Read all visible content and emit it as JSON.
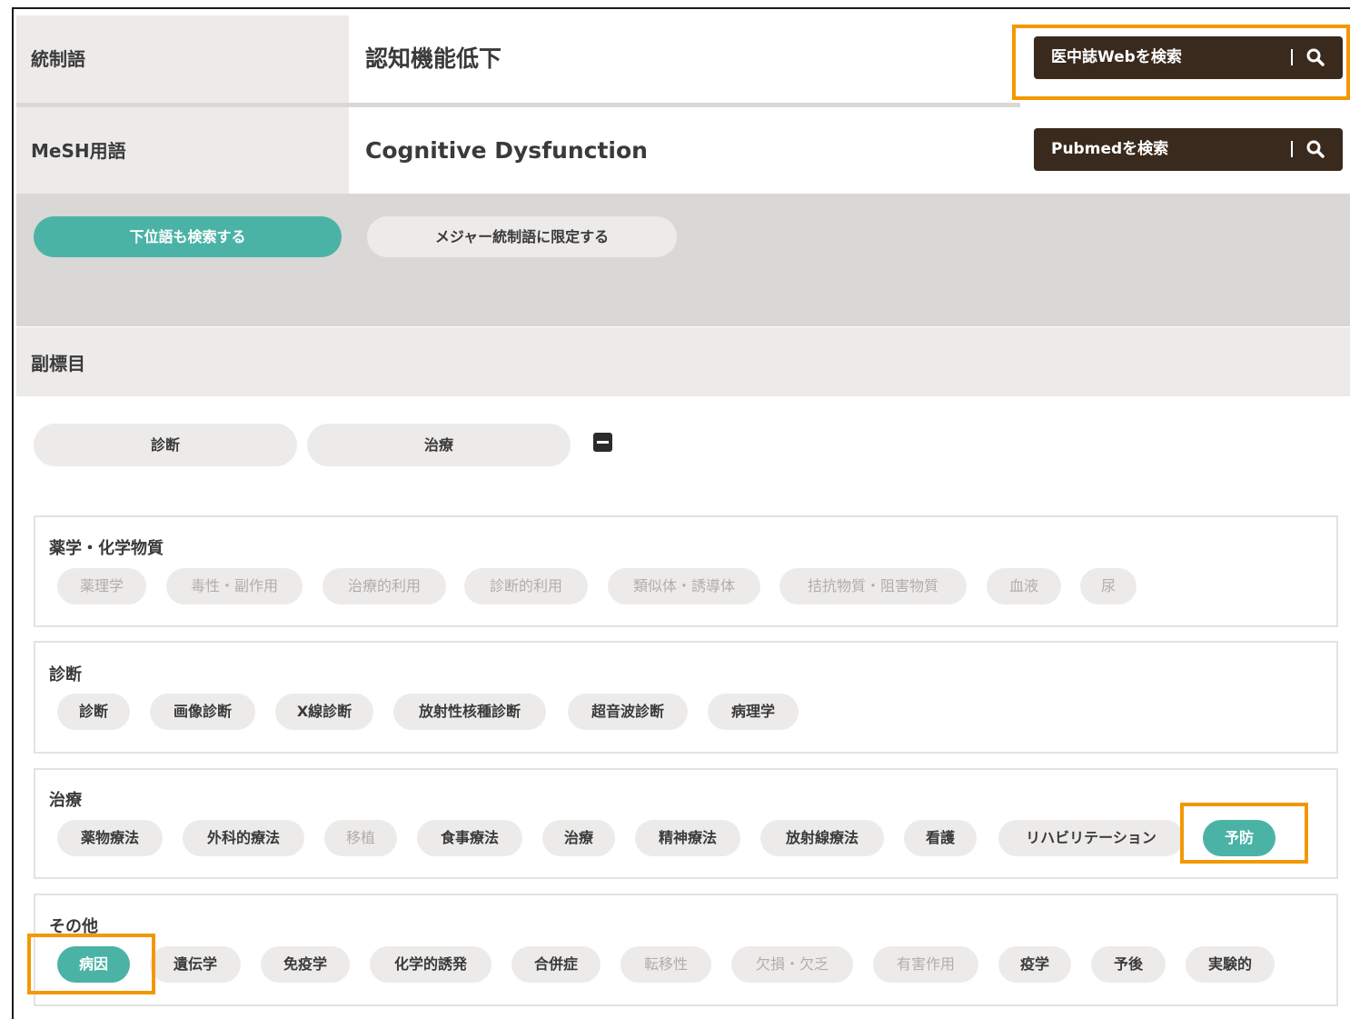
{
  "term": {
    "label": "統制語",
    "value": "認知機能低下"
  },
  "mesh": {
    "label": "MeSH用語",
    "value": "Cognitive Dysfunction"
  },
  "buttons": {
    "ichushi": "医中誌Webを検索",
    "pubmed": "Pubmedを検索"
  },
  "options": {
    "include_narrower": "下位語も検索する",
    "major_only": "メジャー統制語に限定する"
  },
  "subheadings": {
    "title": "副標目",
    "quick": [
      "診断",
      "治療"
    ],
    "groups": [
      {
        "title": "薬学・化学物質",
        "tags": [
          "薬理学",
          "毒性・副作用",
          "治療的利用",
          "診断的利用",
          "類似体・誘導体",
          "拮抗物質・阻害物質",
          "血液",
          "尿"
        ]
      },
      {
        "title": "診断",
        "tags": [
          "診断",
          "画像診断",
          "X線診断",
          "放射性核種診断",
          "超音波診断",
          "病理学"
        ]
      },
      {
        "title": "治療",
        "tags": [
          "薬物療法",
          "外科的療法",
          "移植",
          "食事療法",
          "治療",
          "精神療法",
          "放射線療法",
          "看護",
          "リハビリテーション",
          "予防"
        ]
      },
      {
        "title": "その他",
        "tags": [
          "病因",
          "遺伝学",
          "免疫学",
          "化学的誘発",
          "合併症",
          "転移性",
          "欠損・欠乏",
          "有害作用",
          "疫学",
          "予後",
          "実験的"
        ]
      }
    ]
  },
  "colors": {
    "accent": "#4bb3a6",
    "dark_button": "#3a2a1e",
    "highlight": "#f39800"
  }
}
